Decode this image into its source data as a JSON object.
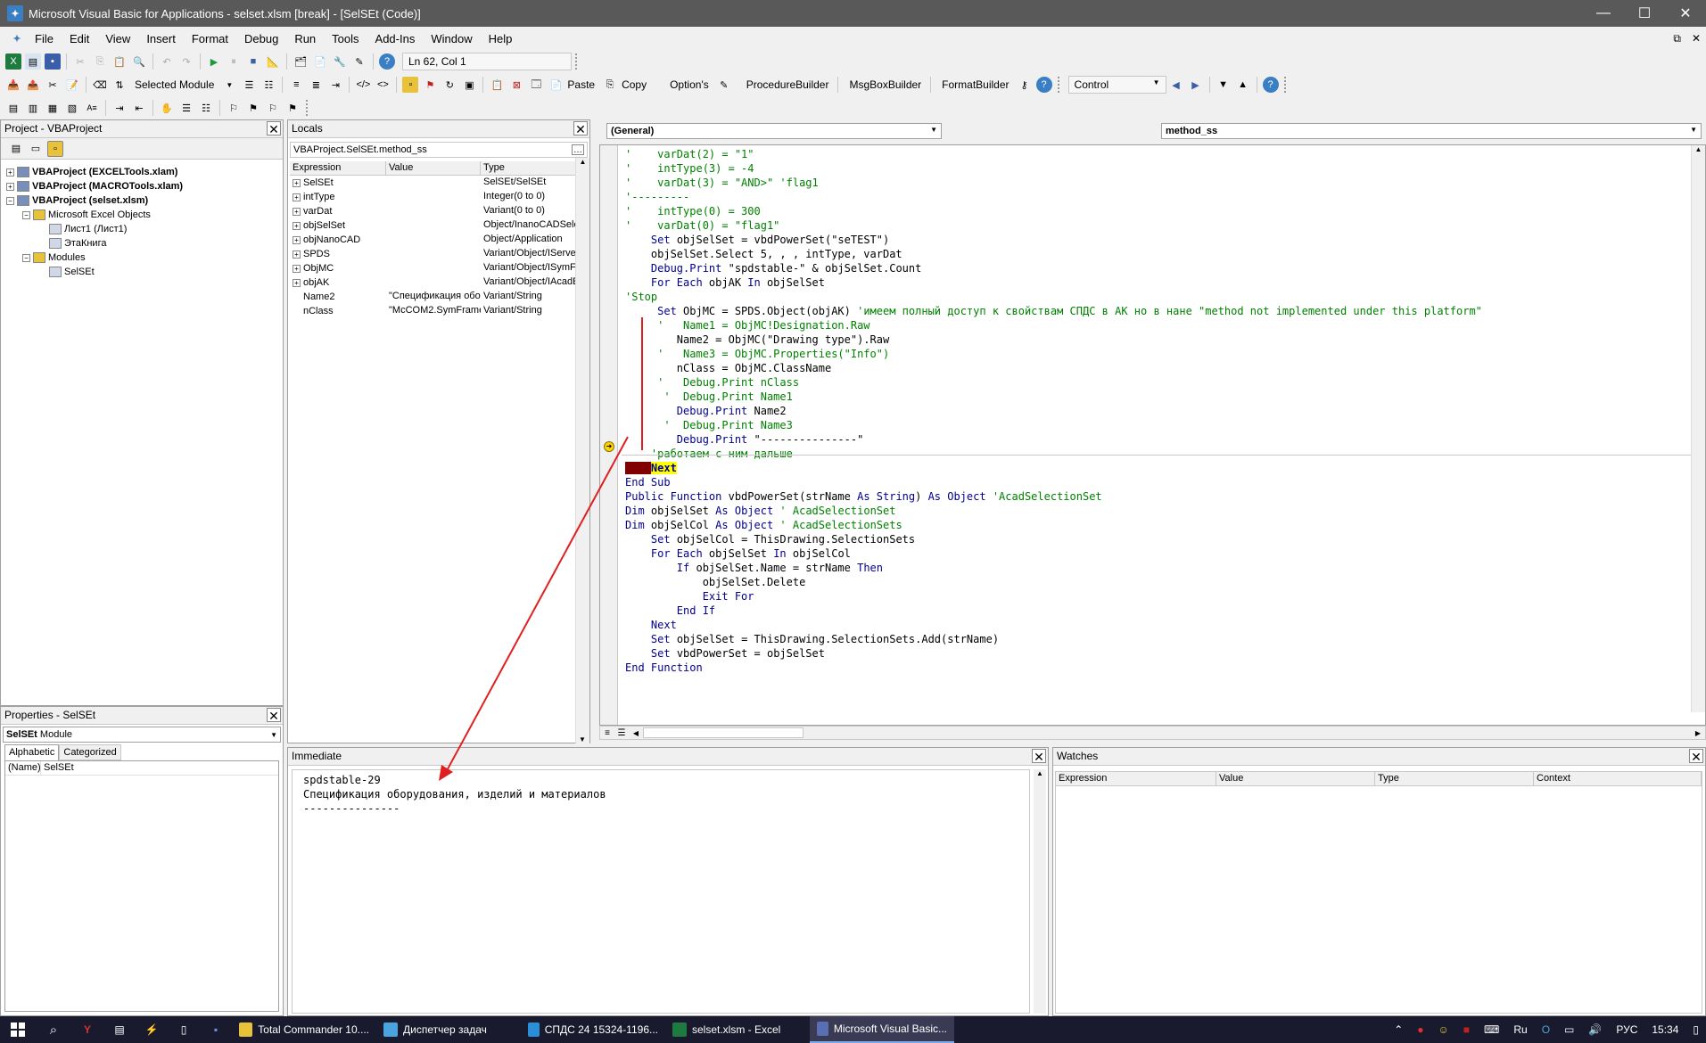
{
  "window": {
    "title": "Microsoft Visual Basic for Applications - selset.xlsm [break] - [SelSEt (Code)]",
    "minimize": "—",
    "maximize": "☐",
    "close": "✕"
  },
  "menu": [
    "File",
    "Edit",
    "View",
    "Insert",
    "Format",
    "Debug",
    "Run",
    "Tools",
    "Add-Ins",
    "Window",
    "Help"
  ],
  "toolbar1": {
    "position": "Ln 62, Col 1"
  },
  "toolbar2": {
    "selected_module": "Selected Module",
    "paste": "Paste",
    "copy": "Copy",
    "options": "Option's",
    "procedure_builder": "ProcedureBuilder",
    "msgbox_builder": "MsgBoxBuilder",
    "format_builder": "FormatBuilder",
    "control": "Control"
  },
  "project": {
    "title": "Project - VBAProject",
    "tree": [
      {
        "label": "VBAProject (EXCELTools.xlam)",
        "bold": true,
        "level": 0,
        "exp": "+"
      },
      {
        "label": "VBAProject (MACROTools.xlam)",
        "bold": true,
        "level": 0,
        "exp": "+"
      },
      {
        "label": "VBAProject (selset.xlsm)",
        "bold": true,
        "level": 0,
        "exp": "−"
      },
      {
        "label": "Microsoft Excel Objects",
        "bold": false,
        "level": 1,
        "exp": "−"
      },
      {
        "label": "Лист1 (Лист1)",
        "bold": false,
        "level": 2,
        "exp": ""
      },
      {
        "label": "ЭтаКнига",
        "bold": false,
        "level": 2,
        "exp": ""
      },
      {
        "label": "Modules",
        "bold": false,
        "level": 1,
        "exp": "−"
      },
      {
        "label": "SelSEt",
        "bold": false,
        "level": 2,
        "exp": ""
      }
    ]
  },
  "properties": {
    "title": "Properties - SelSEt",
    "object": "SelSEt",
    "object_type": "Module",
    "tab_alphabetic": "Alphabetic",
    "tab_categorized": "Categorized",
    "row_name": "(Name)",
    "row_value": "SelSEt"
  },
  "locals": {
    "title": "Locals",
    "context": "VBAProject.SelSEt.method_ss",
    "headers": [
      "Expression",
      "Value",
      "Type"
    ],
    "rows": [
      {
        "exp": "SelSEt",
        "value": "",
        "type": "SelSEt/SelSEt",
        "box": true
      },
      {
        "exp": "intType",
        "value": "",
        "type": "Integer(0 to 0)",
        "box": true
      },
      {
        "exp": "varDat",
        "value": "",
        "type": "Variant(0 to 0)",
        "box": true
      },
      {
        "exp": "objSelSet",
        "value": "",
        "type": "Object/InanoCADSele",
        "box": true
      },
      {
        "exp": "objNanoCAD",
        "value": "",
        "type": "Object/Application",
        "box": true
      },
      {
        "exp": "SPDS",
        "value": "",
        "type": "Variant/Object/IServe",
        "box": true
      },
      {
        "exp": "ObjMC",
        "value": "",
        "type": "Variant/Object/ISymFr",
        "box": true
      },
      {
        "exp": "objAK",
        "value": "",
        "type": "Variant/Object/IAcadE",
        "box": true
      },
      {
        "exp": "Name2",
        "value": "\"Спецификация обор",
        "type": "Variant/String",
        "box": false
      },
      {
        "exp": "nClass",
        "value": "\"McCOM2.SymFrame\"",
        "type": "Variant/String",
        "box": false
      }
    ]
  },
  "code": {
    "object_combo": "(General)",
    "proc_combo": "method_ss",
    "lines": [
      [
        [
          "'    varDat(2) = \"1\"",
          "cm"
        ]
      ],
      [
        [
          "'    intType(3) = -4",
          "cm"
        ]
      ],
      [
        [
          "'    varDat(3) = \"AND>\" 'flag1",
          "cm"
        ]
      ],
      [
        [
          "'---------",
          "cm"
        ]
      ],
      [
        [
          "'    intType(0) = 300",
          "cm"
        ]
      ],
      [
        [
          "'    varDat(0) = \"flag1\"",
          "cm"
        ]
      ],
      [
        [
          "    ",
          ""
        ],
        [
          "Set",
          "kw"
        ],
        [
          " objSelSet = vbdPowerSet(\"seTEST\")",
          ""
        ]
      ],
      [
        [
          "    objSelSet.Select 5, , , intType, varDat",
          ""
        ]
      ],
      [
        [
          "    ",
          ""
        ],
        [
          "Debug.Print",
          "kw"
        ],
        [
          " \"spdstable-\" & objSelSet.Count",
          ""
        ]
      ],
      [
        [
          "    ",
          ""
        ],
        [
          "For Each",
          "kw"
        ],
        [
          " objAK ",
          ""
        ],
        [
          "In",
          "kw"
        ],
        [
          " objSelSet",
          ""
        ]
      ],
      [
        [
          "'Stop",
          "cm"
        ]
      ],
      [
        [
          "     ",
          ""
        ],
        [
          "Set",
          "kw"
        ],
        [
          " ObjMC = SPDS.Object(objAK) ",
          ""
        ],
        [
          "'имеем полный доступ к свойствам СПДС в АК но в нане \"method not implemented under this platform\"",
          "cm"
        ]
      ],
      [
        [
          "     '   Name1 = ObjMC!Designation.Raw",
          "cm"
        ]
      ],
      [
        [
          "        Name2 = ObjMC(\"Drawing type\").Raw",
          ""
        ]
      ],
      [
        [
          "     '   Name3 = ObjMC.Properties(\"Info\")",
          "cm"
        ]
      ],
      [
        [
          "        nClass = ObjMC.ClassName",
          ""
        ]
      ],
      [
        [
          "     '   Debug.Print nClass",
          "cm"
        ]
      ],
      [
        [
          "      '  Debug.Print Name1",
          "cm"
        ]
      ],
      [
        [
          "        ",
          ""
        ],
        [
          "Debug.Print",
          "kw"
        ],
        [
          " Name2",
          ""
        ]
      ],
      [
        [
          "      '  Debug.Print Name3",
          "cm"
        ]
      ],
      [
        [
          "        ",
          ""
        ],
        [
          "Debug.Print",
          "kw"
        ],
        [
          " \"---------------\"",
          ""
        ]
      ],
      [
        [
          "    'работаем с ним дальше",
          "cm"
        ]
      ],
      [
        [
          "    ",
          "brk"
        ],
        [
          "Next",
          "cur"
        ]
      ],
      [
        [
          "End Sub",
          "kw"
        ]
      ],
      [
        [
          "Public Function",
          "kw"
        ],
        [
          " vbdPowerSet(strName ",
          ""
        ],
        [
          "As String",
          "kw"
        ],
        [
          ") ",
          ""
        ],
        [
          "As Object",
          "kw"
        ],
        [
          " 'AcadSelectionSet",
          "cm"
        ]
      ],
      [
        [
          "Dim",
          "kw"
        ],
        [
          " objSelSet ",
          ""
        ],
        [
          "As Object",
          "kw"
        ],
        [
          " ' AcadSelectionSet",
          "cm"
        ]
      ],
      [
        [
          "Dim",
          "kw"
        ],
        [
          " objSelCol ",
          ""
        ],
        [
          "As Object",
          "kw"
        ],
        [
          " ' AcadSelectionSets",
          "cm"
        ]
      ],
      [
        [
          "    ",
          ""
        ],
        [
          "Set",
          "kw"
        ],
        [
          " objSelCol = ThisDrawing.SelectionSets",
          ""
        ]
      ],
      [
        [
          "    ",
          ""
        ],
        [
          "For Each",
          "kw"
        ],
        [
          " objSelSet ",
          ""
        ],
        [
          "In",
          "kw"
        ],
        [
          " objSelCol",
          ""
        ]
      ],
      [
        [
          "        ",
          ""
        ],
        [
          "If",
          "kw"
        ],
        [
          " objSelSet.Name = strName ",
          ""
        ],
        [
          "Then",
          "kw"
        ]
      ],
      [
        [
          "            objSelSet.Delete",
          ""
        ]
      ],
      [
        [
          "            ",
          ""
        ],
        [
          "Exit For",
          "kw"
        ]
      ],
      [
        [
          "        ",
          ""
        ],
        [
          "End If",
          "kw"
        ]
      ],
      [
        [
          "    ",
          ""
        ],
        [
          "Next",
          "kw"
        ]
      ],
      [
        [
          "    ",
          ""
        ],
        [
          "Set",
          "kw"
        ],
        [
          " objSelSet = ThisDrawing.SelectionSets.Add(strName)",
          ""
        ]
      ],
      [
        [
          "    ",
          ""
        ],
        [
          "Set",
          "kw"
        ],
        [
          " vbdPowerSet = objSelSet",
          ""
        ]
      ],
      [
        [
          "End Function",
          "kw"
        ]
      ]
    ]
  },
  "immediate": {
    "title": "Immediate",
    "lines": [
      "spdstable-29",
      "Спецификация оборудования, изделий и материалов",
      "---------------"
    ]
  },
  "watches": {
    "title": "Watches",
    "headers": [
      "Expression",
      "Value",
      "Type",
      "Context"
    ]
  },
  "taskbar": {
    "apps": [
      {
        "label": "Total Commander 10....",
        "color": "#e8c23a",
        "active": false
      },
      {
        "label": "Диспетчер задач",
        "color": "#4aa3df",
        "active": false
      },
      {
        "label": "СПДС 24 15324-1196...",
        "color": "#2a8fd8",
        "active": false
      },
      {
        "label": "selset.xlsm - Excel",
        "color": "#1f7a3f",
        "active": false
      },
      {
        "label": "Microsoft Visual Basic...",
        "color": "#5a6fb3",
        "active": true
      }
    ],
    "lang": "РУС",
    "time": "15:34"
  },
  "colors": {
    "keyword": "#00008b",
    "comment": "#008000",
    "breakpoint": "#800000",
    "current": "#ffff00",
    "arrow": "#e02020"
  }
}
